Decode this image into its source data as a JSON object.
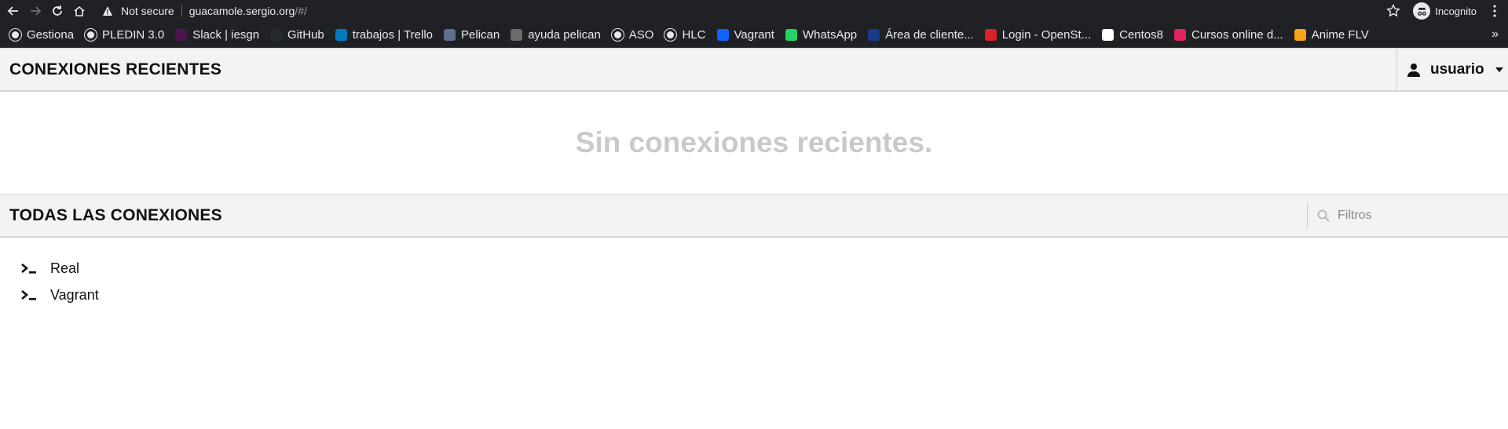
{
  "browser": {
    "security_label": "Not secure",
    "url_host": "guacamole.sergio.org",
    "url_path": "/#/",
    "incognito_label": "Incognito",
    "bookmarks": [
      {
        "label": "Gestiona",
        "icon": "globe-icon",
        "color": "#9aa0a6"
      },
      {
        "label": "PLEDIN 3.0",
        "icon": "globe-icon",
        "color": "#9aa0a6"
      },
      {
        "label": "Slack | iesgn",
        "icon": "slack-icon",
        "color": "#4a154b"
      },
      {
        "label": "GitHub",
        "icon": "github-icon",
        "color": "#24292e"
      },
      {
        "label": "trabajos | Trello",
        "icon": "trello-icon",
        "color": "#0079bf"
      },
      {
        "label": "Pelican",
        "icon": "pelican-icon",
        "color": "#5f6f8f"
      },
      {
        "label": "ayuda pelican",
        "icon": "pelican-icon",
        "color": "#6b6b6b"
      },
      {
        "label": "ASO",
        "icon": "globe-icon",
        "color": "#9aa0a6"
      },
      {
        "label": "HLC",
        "icon": "globe-icon",
        "color": "#9aa0a6"
      },
      {
        "label": "Vagrant",
        "icon": "vagrant-icon",
        "color": "#1563ff"
      },
      {
        "label": "WhatsApp",
        "icon": "whatsapp-icon",
        "color": "#25d366"
      },
      {
        "label": "Área de cliente...",
        "icon": "cloud-icon",
        "color": "#1a3a8a"
      },
      {
        "label": "Login - OpenSt...",
        "icon": "openstack-icon",
        "color": "#d9222a"
      },
      {
        "label": "Centos8",
        "icon": "centos-icon",
        "color": "#ffffff"
      },
      {
        "label": "Cursos online d...",
        "icon": "cursos-icon",
        "color": "#e0245e"
      },
      {
        "label": "Anime FLV",
        "icon": "animeflv-icon",
        "color": "#f7a21b"
      }
    ],
    "overflow_label": "»"
  },
  "recent": {
    "title": "CONEXIONES RECIENTES",
    "empty_message": "Sin conexiones recientes."
  },
  "user_menu": {
    "username": "usuario"
  },
  "all": {
    "title": "TODAS LAS CONEXIONES",
    "filter_placeholder": "Filtros",
    "connections": [
      {
        "name": "Real"
      },
      {
        "name": "Vagrant"
      }
    ]
  }
}
